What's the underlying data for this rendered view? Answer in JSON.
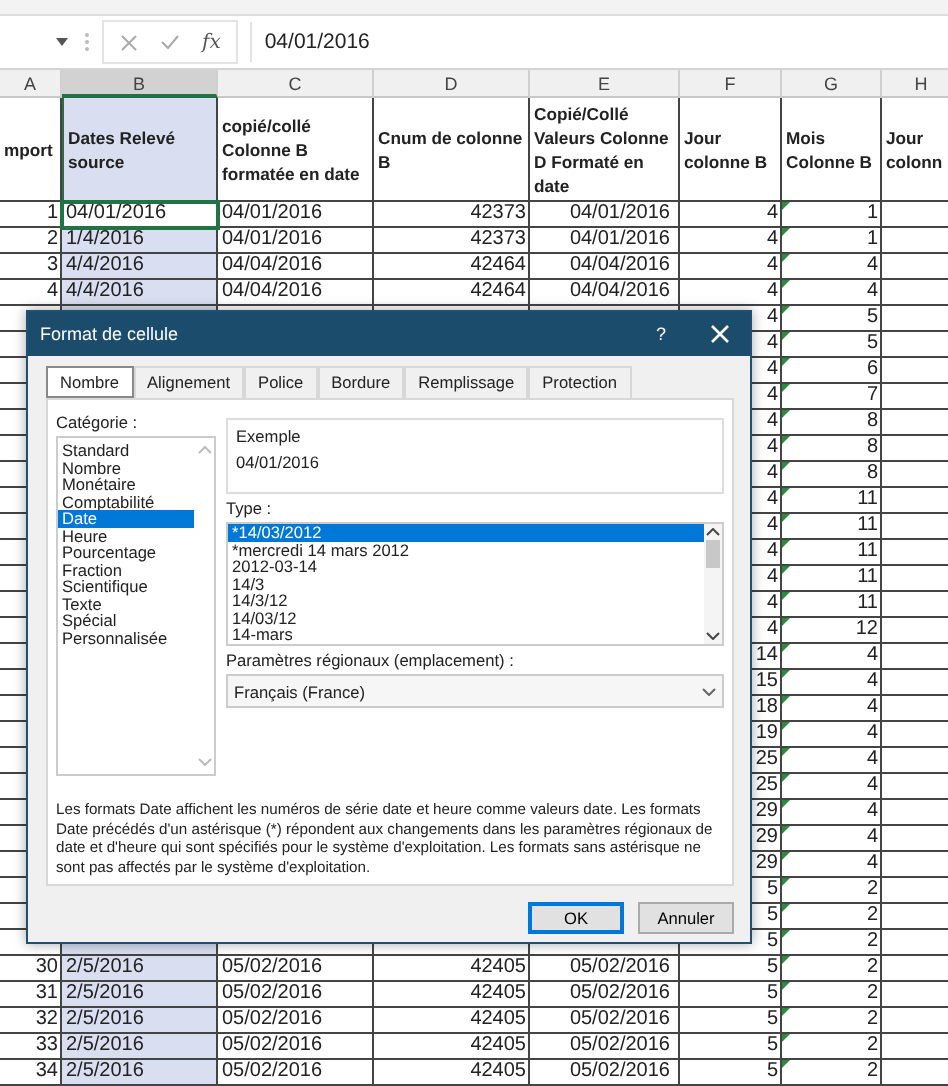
{
  "formula_bar": {
    "function_label": "fx",
    "value": "04/01/2016"
  },
  "sheet": {
    "columns": [
      {
        "letter": "A",
        "header": "mport",
        "selected": false,
        "marker": false
      },
      {
        "letter": "B",
        "header": "Dates Relevé source",
        "selected": true,
        "marker": false
      },
      {
        "letter": "C",
        "header": "copié/collé Colonne B formatée en date",
        "selected": false,
        "marker": false
      },
      {
        "letter": "D",
        "header": "Cnum de colonne B",
        "selected": false,
        "marker": false
      },
      {
        "letter": "E",
        "header": "Copié/Collé Valeurs Colonne D Formaté en date",
        "selected": false,
        "marker": false
      },
      {
        "letter": "F",
        "header": "Jour colonne B",
        "selected": false,
        "marker": false
      },
      {
        "letter": "G",
        "header": "Mois Colonne B",
        "selected": false,
        "marker": true
      },
      {
        "letter": "H",
        "header": "Jour colonn",
        "selected": false,
        "marker": false
      }
    ],
    "rows": [
      {
        "active": true,
        "cells": {
          "A": "1",
          "B": "04/01/2016",
          "C": "04/01/2016",
          "D": "42373",
          "E": "04/01/2016",
          "F": "4",
          "G": "1"
        }
      },
      {
        "active": false,
        "cells": {
          "A": "2",
          "B": "1/4/2016",
          "C": "04/01/2016",
          "D": "42373",
          "E": "04/01/2016",
          "F": "4",
          "G": "1"
        }
      },
      {
        "active": false,
        "cells": {
          "A": "3",
          "B": "4/4/2016",
          "C": "04/04/2016",
          "D": "42464",
          "E": "04/04/2016",
          "F": "4",
          "G": "4"
        }
      },
      {
        "active": false,
        "cells": {
          "A": "4",
          "B": "4/4/2016",
          "C": "04/04/2016",
          "D": "42464",
          "E": "04/04/2016",
          "F": "4",
          "G": "4"
        }
      },
      {
        "active": false,
        "cells": {
          "F": "4",
          "G": "5"
        }
      },
      {
        "active": false,
        "cells": {
          "F": "4",
          "G": "5"
        }
      },
      {
        "active": false,
        "cells": {
          "F": "4",
          "G": "6"
        }
      },
      {
        "active": false,
        "cells": {
          "F": "4",
          "G": "7"
        }
      },
      {
        "active": false,
        "cells": {
          "F": "4",
          "G": "8"
        }
      },
      {
        "active": false,
        "cells": {
          "F": "4",
          "G": "8"
        }
      },
      {
        "active": false,
        "cells": {
          "F": "4",
          "G": "8"
        }
      },
      {
        "active": false,
        "cells": {
          "F": "4",
          "G": "11"
        }
      },
      {
        "active": false,
        "cells": {
          "F": "4",
          "G": "11"
        }
      },
      {
        "active": false,
        "cells": {
          "F": "4",
          "G": "11"
        }
      },
      {
        "active": false,
        "cells": {
          "F": "4",
          "G": "11"
        }
      },
      {
        "active": false,
        "cells": {
          "F": "4",
          "G": "11"
        }
      },
      {
        "active": false,
        "cells": {
          "F": "4",
          "G": "12"
        }
      },
      {
        "active": false,
        "cells": {
          "F": "14",
          "G": "4"
        }
      },
      {
        "active": false,
        "cells": {
          "F": "15",
          "G": "4"
        }
      },
      {
        "active": false,
        "cells": {
          "F": "18",
          "G": "4"
        }
      },
      {
        "active": false,
        "cells": {
          "F": "19",
          "G": "4"
        }
      },
      {
        "active": false,
        "cells": {
          "F": "25",
          "G": "4"
        }
      },
      {
        "active": false,
        "cells": {
          "F": "25",
          "G": "4"
        }
      },
      {
        "active": false,
        "cells": {
          "F": "29",
          "G": "4"
        }
      },
      {
        "active": false,
        "cells": {
          "F": "29",
          "G": "4"
        }
      },
      {
        "active": false,
        "cells": {
          "F": "29",
          "G": "4"
        }
      },
      {
        "active": false,
        "cells": {
          "F": "5",
          "G": "2"
        }
      },
      {
        "active": false,
        "cells": {
          "F": "5",
          "G": "2"
        }
      },
      {
        "active": false,
        "cells": {
          "F": "5",
          "G": "2"
        }
      },
      {
        "active": false,
        "cells": {
          "A": "30",
          "B": "2/5/2016",
          "C": "05/02/2016",
          "D": "42405",
          "E": "05/02/2016",
          "F": "5",
          "G": "2"
        }
      },
      {
        "active": false,
        "cells": {
          "A": "31",
          "B": "2/5/2016",
          "C": "05/02/2016",
          "D": "42405",
          "E": "05/02/2016",
          "F": "5",
          "G": "2"
        }
      },
      {
        "active": false,
        "cells": {
          "A": "32",
          "B": "2/5/2016",
          "C": "05/02/2016",
          "D": "42405",
          "E": "05/02/2016",
          "F": "5",
          "G": "2"
        }
      },
      {
        "active": false,
        "cells": {
          "A": "33",
          "B": "2/5/2016",
          "C": "05/02/2016",
          "D": "42405",
          "E": "05/02/2016",
          "F": "5",
          "G": "2"
        }
      },
      {
        "active": false,
        "cells": {
          "A": "34",
          "B": "2/5/2016",
          "C": "05/02/2016",
          "D": "42405",
          "E": "05/02/2016",
          "F": "5",
          "G": "2"
        }
      }
    ]
  },
  "dialog": {
    "title": "Format de cellule",
    "help": "?",
    "tabs": [
      {
        "label": "Nombre",
        "selected": true
      },
      {
        "label": "Alignement",
        "selected": false
      },
      {
        "label": "Police",
        "selected": false
      },
      {
        "label": "Bordure",
        "selected": false
      },
      {
        "label": "Remplissage",
        "selected": false
      },
      {
        "label": "Protection",
        "selected": false
      }
    ],
    "category_label": "Catégorie :",
    "categories": [
      {
        "label": "Standard",
        "selected": false
      },
      {
        "label": "Nombre",
        "selected": false
      },
      {
        "label": "Monétaire",
        "selected": false
      },
      {
        "label": "Comptabilité",
        "selected": false
      },
      {
        "label": "Date",
        "selected": true
      },
      {
        "label": "Heure",
        "selected": false
      },
      {
        "label": "Pourcentage",
        "selected": false
      },
      {
        "label": "Fraction",
        "selected": false
      },
      {
        "label": "Scientifique",
        "selected": false
      },
      {
        "label": "Texte",
        "selected": false
      },
      {
        "label": "Spécial",
        "selected": false
      },
      {
        "label": "Personnalisée",
        "selected": false
      }
    ],
    "sample_label": "Exemple",
    "sample_value": "04/01/2016",
    "type_label": "Type :",
    "types": [
      {
        "label": "*14/03/2012",
        "selected": true
      },
      {
        "label": "*mercredi 14 mars 2012",
        "selected": false
      },
      {
        "label": "2012-03-14",
        "selected": false
      },
      {
        "label": "14/3",
        "selected": false
      },
      {
        "label": "14/3/12",
        "selected": false
      },
      {
        "label": "14/03/12",
        "selected": false
      },
      {
        "label": "14-mars",
        "selected": false
      }
    ],
    "locale_label": "Paramètres régionaux (emplacement) :",
    "locale_value": "Français (France)",
    "description": "Les formats Date affichent les numéros de série date et heure comme valeurs date. Les formats Date précédés d'un astérisque (*) répondent aux changements dans les paramètres régionaux de date et d'heure qui sont spécifiés pour le système d'exploitation. Les formats sans astérisque ne sont pas affectés par le système d'exploitation.",
    "buttons": [
      {
        "label": "OK",
        "kind": "default"
      },
      {
        "label": "Annuler",
        "kind": "normal"
      }
    ]
  }
}
